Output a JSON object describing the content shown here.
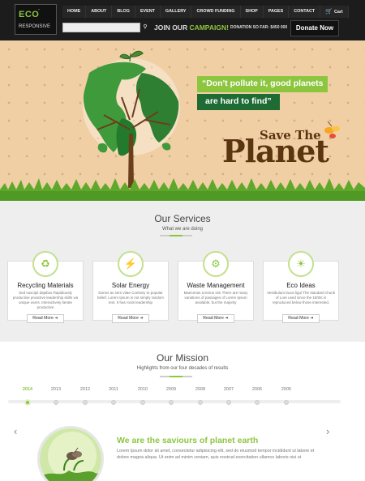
{
  "logo": {
    "brand": "ECO",
    "sup": "\"",
    "tagline": "RESPONSIVE"
  },
  "nav": {
    "items": [
      "HOME",
      "ABOUT",
      "BLOG",
      "EVENT",
      "GALLERY",
      "CROWD FUNDING",
      "SHOP",
      "PAGES",
      "CONTACT"
    ],
    "cart": "Cart"
  },
  "search": {
    "placeholder": "",
    "icon": "search-icon"
  },
  "campaign": {
    "prefix": "JOIN OUR ",
    "highlight": "CAMPAIGN!",
    "donation": "DONATION SO FAR: $450 000",
    "donate_button": "Donate Now"
  },
  "hero": {
    "quote_line1": "“Don't pollute it, good planets",
    "quote_line2": "are hard to find”",
    "save_the": "Save The",
    "planet": "Planet"
  },
  "services": {
    "title": "Our Services",
    "subtitle": "What we are doing",
    "cards": [
      {
        "icon": "recycle-icon",
        "glyph": "♻",
        "title": "Recycling Materials",
        "text": "Sed suscipit dapibus Rapidiously productive proactive leadership skills via unique users. Interactively iterate productive",
        "button": "Read More"
      },
      {
        "icon": "bolt-icon",
        "glyph": "⚡",
        "title": "Solar Energy",
        "text": "Dones as sem vitae Contrary to popular belief, Lorem Ipsum is not simply random text. It has roots leadership",
        "button": "Read More"
      },
      {
        "icon": "gear-icon",
        "glyph": "⚙",
        "title": "Waste Management",
        "text": "Maecenas a lectus sim There are many variations of passages of Lorem Ipsum available, but the majority",
        "button": "Read More"
      },
      {
        "icon": "lightbulb-icon",
        "glyph": "☀",
        "title": "Eco Ideas",
        "text": "Vestibulum lacus ligul The standard chunk of Lore used since the 1500s is reproduced below those interested.",
        "button": "Read More"
      }
    ]
  },
  "mission": {
    "title": "Our Mission",
    "subtitle": "Highlights from our four decades of results",
    "years": [
      "2014",
      "2013",
      "2012",
      "2011",
      "2010",
      "2009",
      "2008",
      "2007",
      "2006",
      "2005"
    ],
    "active_year": "2014",
    "prev": "‹",
    "next": "›",
    "headline": "We are the saviours of planet earth",
    "text": "Lorem Ipsum dolor sit amet, consectetur adipisicing elit, sed do eiusmod tempor incididunt ut labore et dolore magna aliqua. Ut enim ad minim veniam, quis nostrud exercitation ullamco laboris nisi ut"
  },
  "colors": {
    "accent": "#8cc63f",
    "dark_green": "#1e6b34",
    "header": "#1c1c1c",
    "hero_bg": "#f1cfa5",
    "brown": "#5b3410"
  }
}
